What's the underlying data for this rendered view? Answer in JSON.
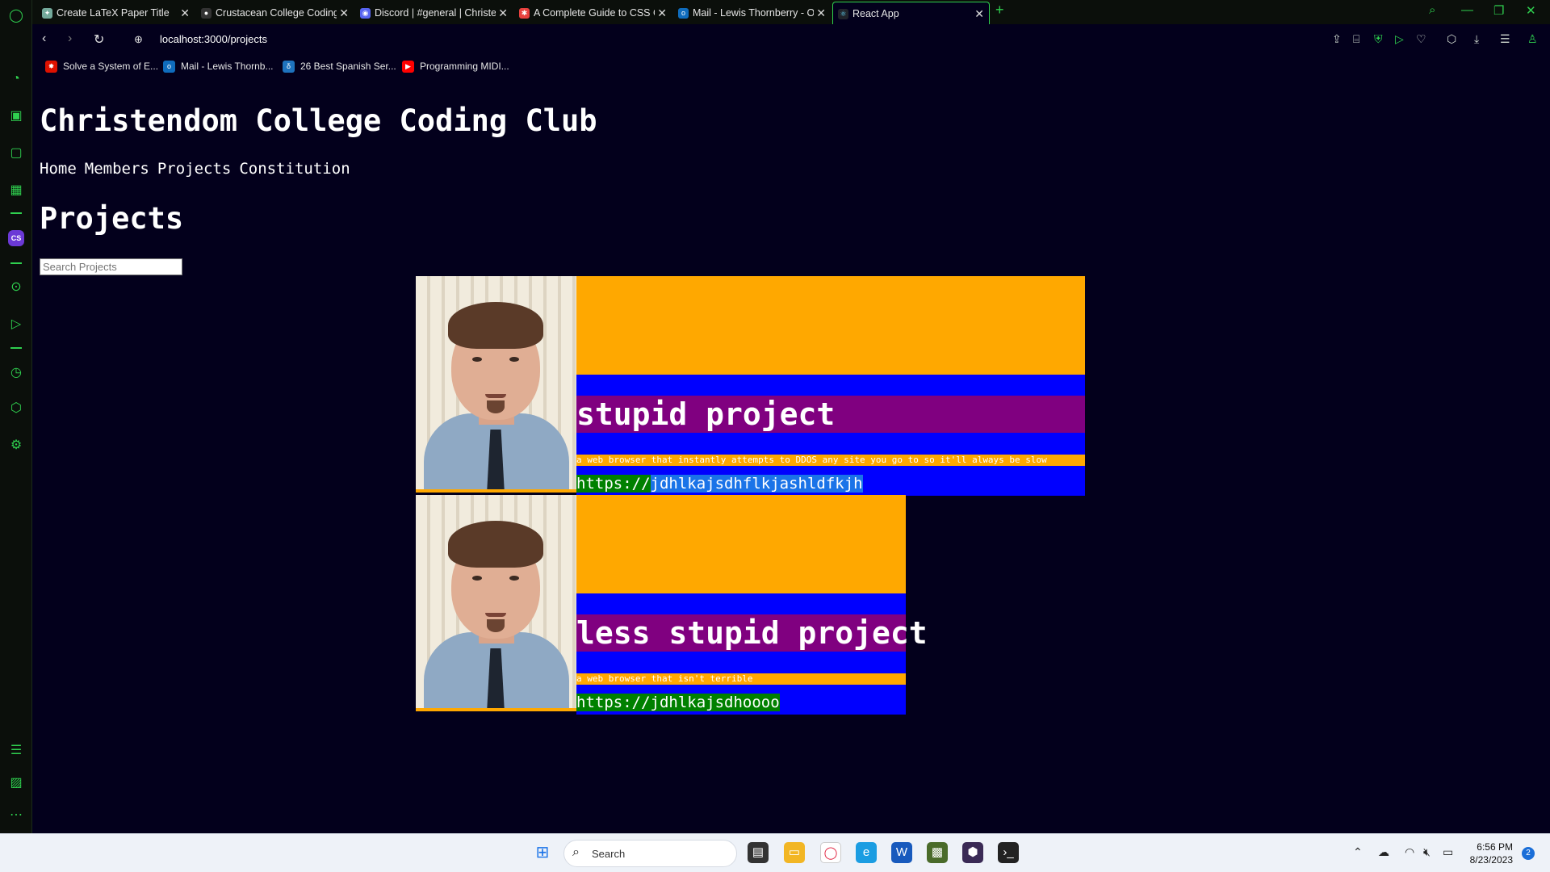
{
  "tabs": [
    {
      "title": "Create LaTeX Paper Title",
      "icon": "chatgpt-icon",
      "color": "#74aa9c"
    },
    {
      "title": "Crustacean College Coding",
      "icon": "github-icon",
      "color": "#333333"
    },
    {
      "title": "Discord | #general | Christe",
      "icon": "discord-icon",
      "color": "#5865f2"
    },
    {
      "title": "A Complete Guide to CSS G",
      "icon": "css-tricks-icon",
      "color": "#e8413e"
    },
    {
      "title": "Mail - Lewis Thornberry - O",
      "icon": "outlook-icon",
      "color": "#0f6cbd"
    },
    {
      "title": "React App",
      "icon": "react-icon",
      "color": "#61dafb"
    }
  ],
  "address": {
    "url": "localhost:3000/projects"
  },
  "bookmarks": [
    {
      "label": "Solve a System of E...",
      "icon": "wolfram-icon",
      "color": "#dd1100"
    },
    {
      "label": "Mail - Lewis Thornb...",
      "icon": "outlook-icon",
      "color": "#0f6cbd"
    },
    {
      "label": "26 Best Spanish Ser...",
      "icon": "bookmark-site-icon",
      "color": "#1e73be"
    },
    {
      "label": "Programming MIDI...",
      "icon": "youtube-icon",
      "color": "#ff0000"
    }
  ],
  "site": {
    "title": "Christendom College Coding Club",
    "nav": [
      "Home",
      "Members",
      "Projects",
      "Constitution"
    ],
    "heading": "Projects",
    "search_placeholder": "Search Projects"
  },
  "projects": [
    {
      "name": "stupid project",
      "description": "a web browser that instantly attempts to DDOS any site you go to so it'll always be slow",
      "link": "https://jdhlkajsdhflkjashldfkjh",
      "link_plain": "https://",
      "link_selected": "jdhlkajsdhflkjashldfkjh"
    },
    {
      "name": "less stupid project",
      "description": "a web browser that isn't terrible",
      "link": "https://jdhlkajsdhoooo"
    }
  ],
  "taskbar": {
    "search_label": "Search",
    "time": "6:56 PM",
    "date": "8/23/2023",
    "notifications": "2"
  },
  "colors": {
    "page_bg": "#03001c",
    "accent_green": "#2fd04f",
    "card_orange": "#ffa800",
    "card_blue": "#0000ff",
    "card_purple": "#800080",
    "link_green": "#008000"
  }
}
